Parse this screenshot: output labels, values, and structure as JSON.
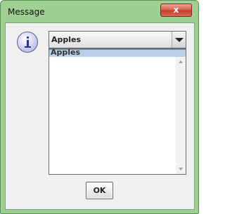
{
  "window": {
    "title": "Message",
    "close_glyph": "x"
  },
  "combo": {
    "selected_value": "Apples"
  },
  "list": {
    "items": [
      "Apples"
    ],
    "selected_index": 0
  },
  "buttons": {
    "ok_label": "OK"
  },
  "icons": {
    "message_type": "info-icon",
    "close": "close-icon",
    "dropdown": "chevron-down-icon"
  },
  "colors": {
    "frame": "#9fcf92",
    "client": "#f0f0f0",
    "selection": "#b8cfe5",
    "close_button": "#c43b23"
  }
}
